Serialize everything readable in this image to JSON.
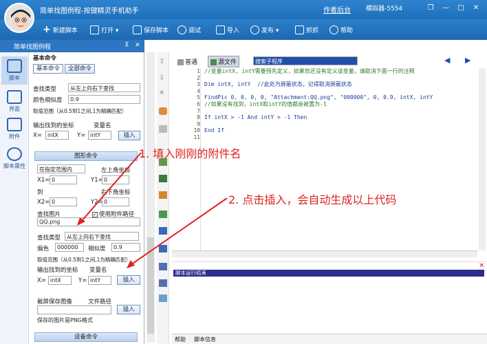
{
  "window": {
    "title": "简单找图例程-按键精灵手机助手",
    "links": "作者后台",
    "counter": "模拟器-5554",
    "controls": [
      "❒",
      "—",
      "□",
      "✕"
    ]
  },
  "toolbar": {
    "items": [
      {
        "icon": "plus-icon",
        "label": "新建脚本"
      },
      {
        "icon": "folder-icon",
        "label": "打开 ▾"
      },
      {
        "icon": "save-icon",
        "label": "保存脚本"
      },
      {
        "icon": "play-icon",
        "label": "调试"
      },
      {
        "icon": "import-icon",
        "label": "导入"
      },
      {
        "icon": "publish-icon",
        "label": "发布 ▾"
      },
      {
        "icon": "camera-icon",
        "label": "抓抓"
      },
      {
        "icon": "help-icon",
        "label": "帮助"
      }
    ]
  },
  "panel": {
    "title": "简单找图例程",
    "pin": "⊼",
    "close": "✕",
    "header": "基本命令",
    "tabs": [
      "基本命令",
      "全部命令"
    ]
  },
  "leftnav": [
    "脚本",
    "界面",
    "附件",
    "脚本属性"
  ],
  "form1": {
    "search_type_label": "查找类型",
    "search_type_value": "从左上向右下查找",
    "similarity_label": "颜色相似度",
    "similarity_value": "0.9",
    "range_hint": "取值范围（从0.5到1之间,1为精确匹配）",
    "output_label": "输出找到的坐标",
    "varname_label": "变量名",
    "x_label": "X=",
    "x_value": "intX",
    "y_label": "Y=",
    "y_value": "intY",
    "insert": "插入"
  },
  "section": "图形命令",
  "form2": {
    "range_mode": "在指定范围内",
    "top_left": "左上角坐标",
    "x1_label": "X1=",
    "x1": "0",
    "y1_label": "Y1=",
    "y1": "0",
    "to": "到",
    "bottom_right": "右下角坐标",
    "x2_label": "X2=",
    "x2": "0",
    "y2_label": "Y2=",
    "y2": "0",
    "pic_label": "查找图片",
    "use_attach": "使用附件路径",
    "pic_value": "QQ.png",
    "search_type_label": "查找类型",
    "search_type_value": "从左上向右下查找",
    "offset_label": "偏色",
    "offset_value": "000000",
    "sim_label": "相似度",
    "sim_value": "0.9",
    "range_hint": "取值范围（从0.5到1之间,1为精确匹配）",
    "output_label": "输出找到的坐标",
    "varname_label": "变量名",
    "x_label": "X=",
    "x_value": "intX",
    "y_label": "Y=",
    "y_value": "intY",
    "insert": "插入",
    "capture_label": "截屏保存图像",
    "path_label": "文件路径",
    "insert2": "插入",
    "save_hint": "保存的图片是PNG格式",
    "device_cmd": "设备命令"
  },
  "editor": {
    "tab_plain": "普通",
    "tab_source": "源文件",
    "combo": "搜索子程序",
    "lines": [
      "//变量intX, intY需要预先定义，如果您还没有定义该变量，请取消下面一行的注释",
      "",
      "Dim intX, intY  //此处为屏蔽状态，记得取消屏蔽状态",
      "",
      "FindPic 0, 0, 0, 0, \"Attachment:QQ.png\", \"000000\", 0, 0.9, intX, intY",
      "//如果没有找到，intX和intY的值都会被置为-1",
      "",
      "If intX > -1 And intY > -1 Then",
      "",
      "End If",
      ""
    ]
  },
  "output": {
    "title": "脚本运行结束",
    "close": "✕"
  },
  "bottomtabs": [
    "帮助",
    "脚本信息"
  ],
  "annotations": {
    "a1": "1. 填入刚刚的附件名",
    "a2": "2. 点击插入，会自动生成以上代码"
  },
  "colors": {
    "accent": "#1f6fb9",
    "annot": "#e02020"
  }
}
